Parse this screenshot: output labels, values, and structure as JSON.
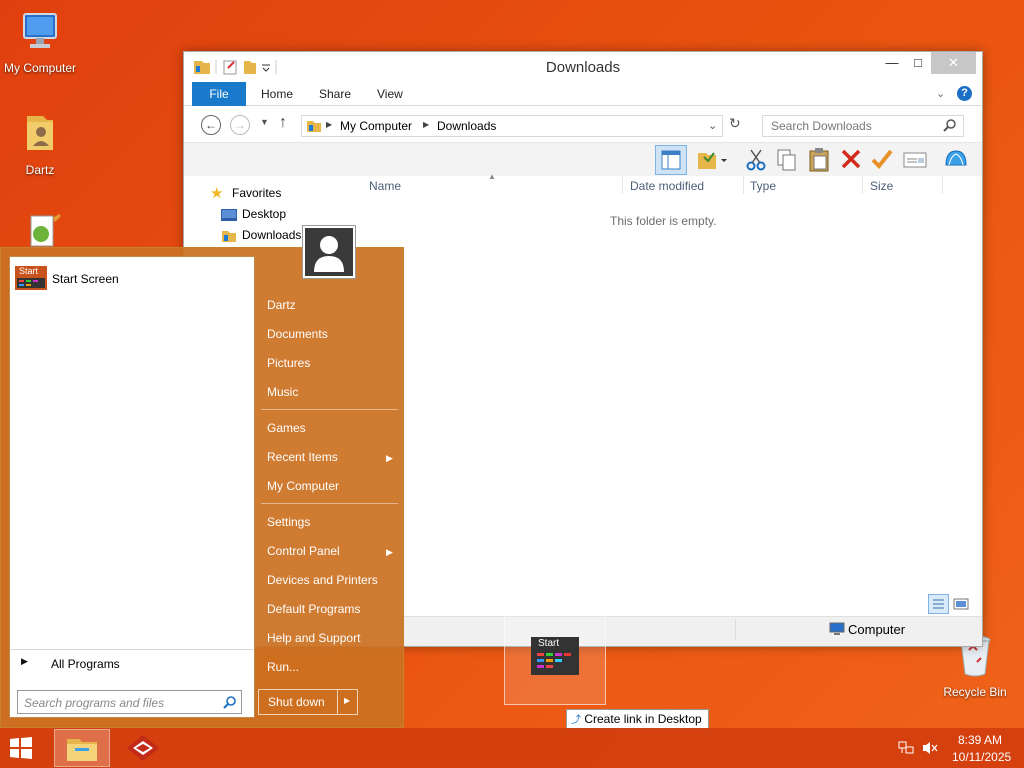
{
  "desktop": {
    "icons": [
      {
        "label": "My Computer"
      },
      {
        "label": "Dartz"
      },
      {
        "label": "Recycle Bin"
      }
    ]
  },
  "explorer": {
    "title": "Downloads",
    "tabs": [
      "File",
      "Home",
      "Share",
      "View"
    ],
    "breadcrumb": [
      "My Computer",
      "Downloads"
    ],
    "search_placeholder": "Search Downloads",
    "nav": {
      "favorites": "Favorites",
      "items": [
        "Desktop",
        "Downloads"
      ]
    },
    "columns": [
      "Name",
      "Date modified",
      "Type",
      "Size"
    ],
    "empty_text": "This folder is empty.",
    "status_location": "Computer"
  },
  "startmenu": {
    "pinned": {
      "tile_label": "Start",
      "label": "Start Screen"
    },
    "all_programs": "All Programs",
    "search_placeholder": "Search programs and files",
    "right_items": [
      {
        "label": "Dartz"
      },
      {
        "label": "Documents"
      },
      {
        "label": "Pictures"
      },
      {
        "label": "Music"
      },
      {
        "label": "Games"
      },
      {
        "label": "Recent Items",
        "submenu": true
      },
      {
        "label": "My Computer"
      },
      {
        "label": "Settings"
      },
      {
        "label": "Control Panel",
        "submenu": true
      },
      {
        "label": "Devices and Printers"
      },
      {
        "label": "Default Programs"
      },
      {
        "label": "Help and Support"
      },
      {
        "label": "Run..."
      }
    ],
    "shutdown": "Shut down"
  },
  "drag": {
    "tile_label": "Start",
    "tooltip": "Create link in Desktop"
  },
  "taskbar": {
    "time": "8:39 AM",
    "date": "10/11/2025"
  },
  "colors": {
    "accent": "#1979ca",
    "desktop": "#e8520f",
    "startmenu": "#cb7121"
  }
}
